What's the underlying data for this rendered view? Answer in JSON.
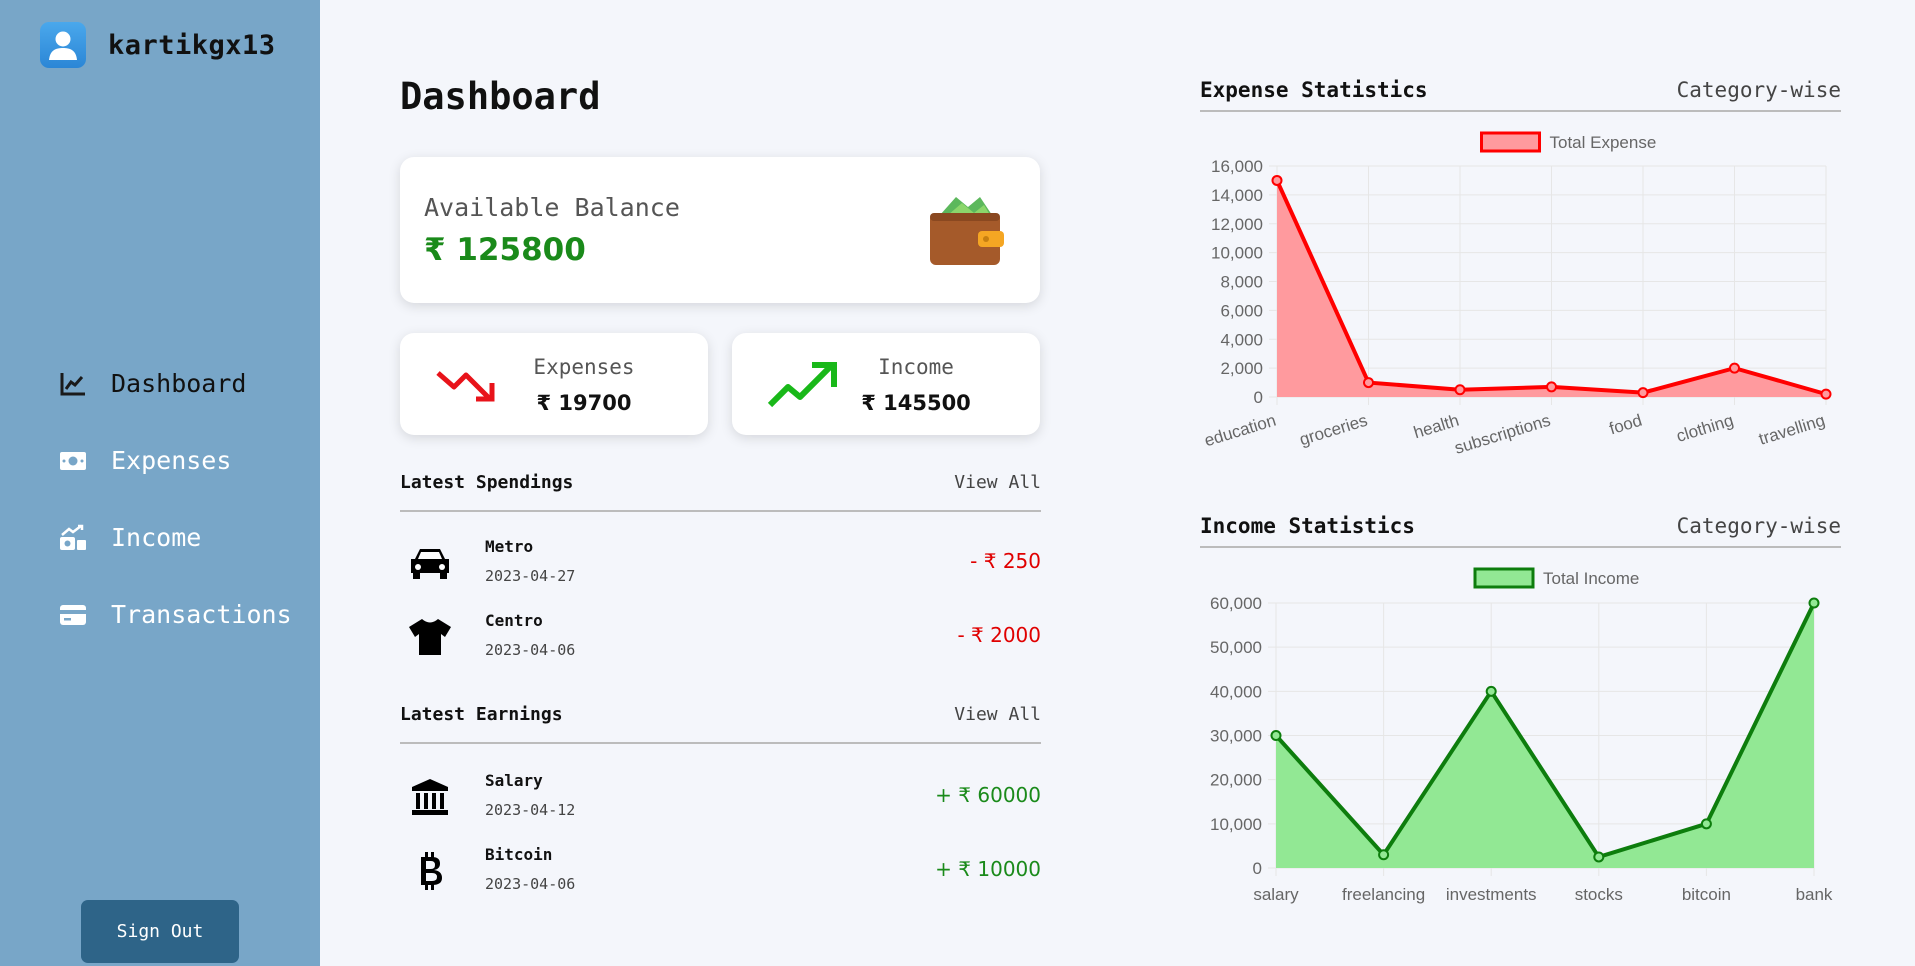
{
  "sidebar": {
    "username": "kartikgx13",
    "items": [
      {
        "label": "Dashboard",
        "icon": "chart-line-icon"
      },
      {
        "label": "Expenses",
        "icon": "money-bill-icon"
      },
      {
        "label": "Income",
        "icon": "money-bill-trend-icon"
      },
      {
        "label": "Transactions",
        "icon": "credit-card-icon"
      }
    ],
    "sign_out": "Sign Out"
  },
  "main": {
    "title": "Dashboard",
    "balance": {
      "label": "Available Balance",
      "value": "₹ 125800"
    },
    "expenses": {
      "label": "Expenses",
      "value": "₹ 19700"
    },
    "income": {
      "label": "Income",
      "value": "₹ 145500"
    },
    "latest_spendings": {
      "title": "Latest Spendings",
      "view_all": "View All",
      "items": [
        {
          "name": "Metro",
          "date": "2023-04-27",
          "amount": "- ₹ 250",
          "icon": "car-icon"
        },
        {
          "name": "Centro",
          "date": "2023-04-06",
          "amount": "- ₹ 2000",
          "icon": "shirt-icon"
        }
      ]
    },
    "latest_earnings": {
      "title": "Latest Earnings",
      "view_all": "View All",
      "items": [
        {
          "name": "Salary",
          "date": "2023-04-12",
          "amount": "+ ₹ 60000",
          "icon": "bank-icon"
        },
        {
          "name": "Bitcoin",
          "date": "2023-04-06",
          "amount": "+ ₹ 10000",
          "icon": "bitcoin-icon"
        }
      ]
    }
  },
  "charts": {
    "expense": {
      "title": "Expense Statistics",
      "subtitle": "Category-wise"
    },
    "income": {
      "title": "Income Statistics",
      "subtitle": "Category-wise"
    }
  },
  "colors": {
    "sidebar": "#78a6c8",
    "sign_out": "#2e6488",
    "negative": "#e00000",
    "positive": "#1a8a1a",
    "expense_line": "#ff0000",
    "expense_fill": "#ff9a9e",
    "income_line": "#0d7d0d",
    "income_fill": "#92e894"
  },
  "chart_data": [
    {
      "type": "area",
      "legend": "top-center",
      "grid": true,
      "categories": [
        "education",
        "groceries",
        "health",
        "subscriptions",
        "food",
        "clothing",
        "travelling"
      ],
      "series": [
        {
          "name": "Total Expense",
          "values": [
            15000,
            1000,
            500,
            700,
            300,
            2000,
            200
          ]
        }
      ],
      "ylim": [
        0,
        16000
      ],
      "yticks": [
        "16,000",
        "14,000",
        "12,000",
        "10,000",
        "8,000",
        "6,000",
        "4,000",
        "2,000",
        "0"
      ]
    },
    {
      "type": "area",
      "legend": "top-center",
      "grid": true,
      "categories": [
        "salary",
        "freelancing",
        "investments",
        "stocks",
        "bitcoin",
        "bank"
      ],
      "series": [
        {
          "name": "Total Income",
          "values": [
            30000,
            3000,
            40000,
            2500,
            10000,
            60000
          ]
        }
      ],
      "ylim": [
        0,
        60000
      ],
      "yticks": [
        "60,000",
        "50,000",
        "40,000",
        "30,000",
        "20,000",
        "10,000",
        "0"
      ]
    }
  ]
}
